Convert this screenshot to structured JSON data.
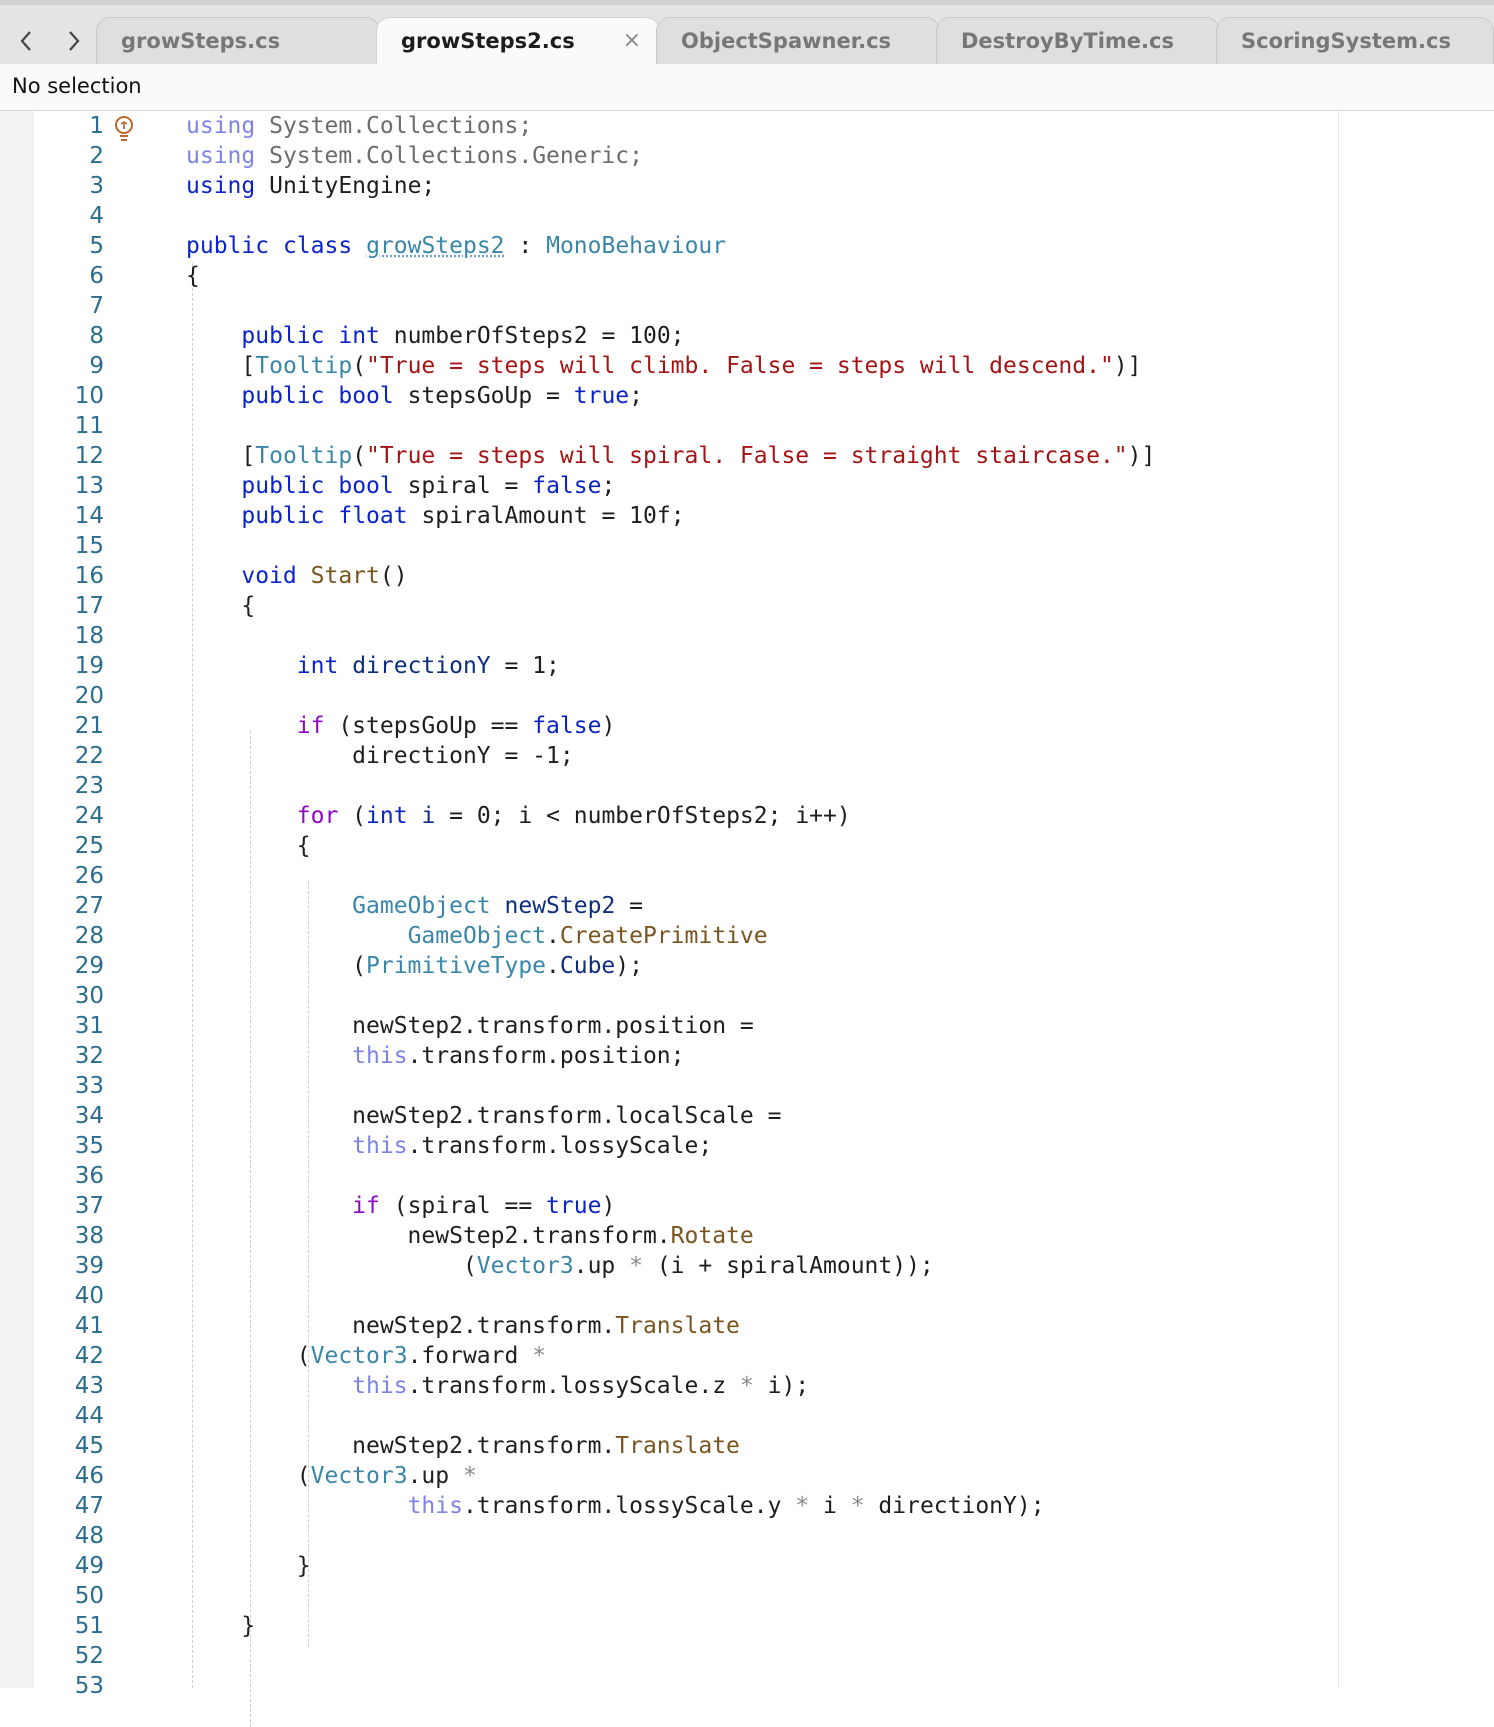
{
  "nav": {
    "back_icon": "chevron-left-icon",
    "forward_icon": "chevron-right-icon"
  },
  "tabs": [
    {
      "label": "growSteps.cs",
      "active": false
    },
    {
      "label": "growSteps2.cs",
      "active": true,
      "close": "×"
    },
    {
      "label": "ObjectSpawner.cs",
      "active": false
    },
    {
      "label": "DestroyByTime.cs",
      "active": false
    },
    {
      "label": "ScoringSystem.cs",
      "active": false
    }
  ],
  "selection_status": "No selection",
  "editor": {
    "line_numbers": [
      "1",
      "2",
      "3",
      "4",
      "5",
      "6",
      "7",
      "8",
      "9",
      "10",
      "11",
      "12",
      "13",
      "14",
      "15",
      "16",
      "17",
      "18",
      "19",
      "20",
      "21",
      "22",
      "23",
      "24",
      "25",
      "26",
      "27",
      "28",
      "29",
      "30",
      "31",
      "32",
      "33",
      "34",
      "35",
      "36",
      "37",
      "38",
      "39",
      "40",
      "41",
      "42",
      "43",
      "44",
      "45",
      "46",
      "47",
      "48",
      "49",
      "50",
      "51",
      "52",
      "53"
    ],
    "code_lines": [
      [
        {
          "t": "using",
          "c": "kwu"
        },
        {
          "t": " System.Collections;",
          "c": "dim"
        }
      ],
      [
        {
          "t": "using",
          "c": "kwu"
        },
        {
          "t": " System.Collections.Generic;",
          "c": "dim"
        }
      ],
      [
        {
          "t": "using",
          "c": "kw"
        },
        {
          "t": " UnityEngine;"
        }
      ],
      [],
      [
        {
          "t": "public",
          "c": "kw"
        },
        {
          "t": " "
        },
        {
          "t": "class",
          "c": "kw"
        },
        {
          "t": " "
        },
        {
          "t": "growSteps2",
          "c": "ty sq"
        },
        {
          "t": " : "
        },
        {
          "t": "MonoBehaviour",
          "c": "ty"
        }
      ],
      [
        {
          "t": "{"
        }
      ],
      [],
      [
        {
          "t": "    "
        },
        {
          "t": "public",
          "c": "kw"
        },
        {
          "t": " "
        },
        {
          "t": "int",
          "c": "kw"
        },
        {
          "t": " numberOfSteps2 = 100;"
        }
      ],
      [
        {
          "t": "    ["
        },
        {
          "t": "Tooltip",
          "c": "ty"
        },
        {
          "t": "("
        },
        {
          "t": "\"True = steps will climb. False = steps will descend.\"",
          "c": "str"
        },
        {
          "t": ")]"
        }
      ],
      [
        {
          "t": "    "
        },
        {
          "t": "public",
          "c": "kw"
        },
        {
          "t": " "
        },
        {
          "t": "bool",
          "c": "kw"
        },
        {
          "t": " stepsGoUp = "
        },
        {
          "t": "true",
          "c": "kw"
        },
        {
          "t": ";"
        }
      ],
      [],
      [
        {
          "t": "    ["
        },
        {
          "t": "Tooltip",
          "c": "ty"
        },
        {
          "t": "("
        },
        {
          "t": "\"True = steps will spiral. False = straight staircase.\"",
          "c": "str"
        },
        {
          "t": ")]"
        }
      ],
      [
        {
          "t": "    "
        },
        {
          "t": "public",
          "c": "kw"
        },
        {
          "t": " "
        },
        {
          "t": "bool",
          "c": "kw"
        },
        {
          "t": " spiral = "
        },
        {
          "t": "false",
          "c": "kw"
        },
        {
          "t": ";"
        }
      ],
      [
        {
          "t": "    "
        },
        {
          "t": "public",
          "c": "kw"
        },
        {
          "t": " "
        },
        {
          "t": "float",
          "c": "kw"
        },
        {
          "t": " spiralAmount = 10f;"
        }
      ],
      [],
      [
        {
          "t": "    "
        },
        {
          "t": "void",
          "c": "kw"
        },
        {
          "t": " "
        },
        {
          "t": "Start",
          "c": "fn"
        },
        {
          "t": "()"
        }
      ],
      [
        {
          "t": "    {"
        }
      ],
      [],
      [
        {
          "t": "        "
        },
        {
          "t": "int",
          "c": "kw"
        },
        {
          "t": " "
        },
        {
          "t": "directionY",
          "c": "id"
        },
        {
          "t": " = 1;"
        }
      ],
      [],
      [
        {
          "t": "        "
        },
        {
          "t": "if",
          "c": "ctl"
        },
        {
          "t": " (stepsGoUp == "
        },
        {
          "t": "false",
          "c": "kw"
        },
        {
          "t": ")"
        }
      ],
      [
        {
          "t": "            directionY = -1;"
        }
      ],
      [],
      [
        {
          "t": "        "
        },
        {
          "t": "for",
          "c": "ctl"
        },
        {
          "t": " ("
        },
        {
          "t": "int",
          "c": "kw"
        },
        {
          "t": " "
        },
        {
          "t": "i",
          "c": "id"
        },
        {
          "t": " = 0; i < numberOfSteps2; i++)"
        }
      ],
      [
        {
          "t": "        {"
        }
      ],
      [],
      [
        {
          "t": "            "
        },
        {
          "t": "GameObject",
          "c": "ty"
        },
        {
          "t": " "
        },
        {
          "t": "newStep2",
          "c": "id"
        },
        {
          "t": " ="
        }
      ],
      [
        {
          "t": "                "
        },
        {
          "t": "GameObject",
          "c": "ty"
        },
        {
          "t": "."
        },
        {
          "t": "CreatePrimitive",
          "c": "fn"
        }
      ],
      [
        {
          "t": "            ("
        },
        {
          "t": "PrimitiveType",
          "c": "ty"
        },
        {
          "t": "."
        },
        {
          "t": "Cube",
          "c": "id"
        },
        {
          "t": ");"
        }
      ],
      [],
      [
        {
          "t": "            newStep2.transform.position ="
        }
      ],
      [
        {
          "t": "            "
        },
        {
          "t": "this",
          "c": "kwu"
        },
        {
          "t": ".transform.position;"
        }
      ],
      [],
      [
        {
          "t": "            newStep2.transform.localScale ="
        }
      ],
      [
        {
          "t": "            "
        },
        {
          "t": "this",
          "c": "kwu"
        },
        {
          "t": ".transform.lossyScale;"
        }
      ],
      [],
      [
        {
          "t": "            "
        },
        {
          "t": "if",
          "c": "ctl"
        },
        {
          "t": " (spiral == "
        },
        {
          "t": "true",
          "c": "kw"
        },
        {
          "t": ")"
        }
      ],
      [
        {
          "t": "                newStep2.transform."
        },
        {
          "t": "Rotate",
          "c": "fn"
        }
      ],
      [
        {
          "t": "                    ("
        },
        {
          "t": "Vector3",
          "c": "ty"
        },
        {
          "t": ".up "
        },
        {
          "t": "*",
          "c": "op"
        },
        {
          "t": " (i + spiralAmount));"
        }
      ],
      [],
      [
        {
          "t": "            newStep2.transform."
        },
        {
          "t": "Translate",
          "c": "fn"
        }
      ],
      [
        {
          "t": "        ("
        },
        {
          "t": "Vector3",
          "c": "ty"
        },
        {
          "t": ".forward "
        },
        {
          "t": "*",
          "c": "op"
        }
      ],
      [
        {
          "t": "            "
        },
        {
          "t": "this",
          "c": "kwu"
        },
        {
          "t": ".transform.lossyScale.z "
        },
        {
          "t": "*",
          "c": "op"
        },
        {
          "t": " i);"
        }
      ],
      [],
      [
        {
          "t": "            newStep2.transform."
        },
        {
          "t": "Translate",
          "c": "fn"
        }
      ],
      [
        {
          "t": "        ("
        },
        {
          "t": "Vector3",
          "c": "ty"
        },
        {
          "t": ".up "
        },
        {
          "t": "*",
          "c": "op"
        }
      ],
      [
        {
          "t": "                "
        },
        {
          "t": "this",
          "c": "kwu"
        },
        {
          "t": ".transform.lossyScale.y "
        },
        {
          "t": "*",
          "c": "op"
        },
        {
          "t": " i "
        },
        {
          "t": "*",
          "c": "op"
        },
        {
          "t": " directionY);"
        }
      ],
      [],
      [
        {
          "t": "        }"
        }
      ],
      [],
      [
        {
          "t": "    }"
        }
      ],
      [],
      []
    ],
    "gutter_icon": "lightbulb-icon"
  }
}
